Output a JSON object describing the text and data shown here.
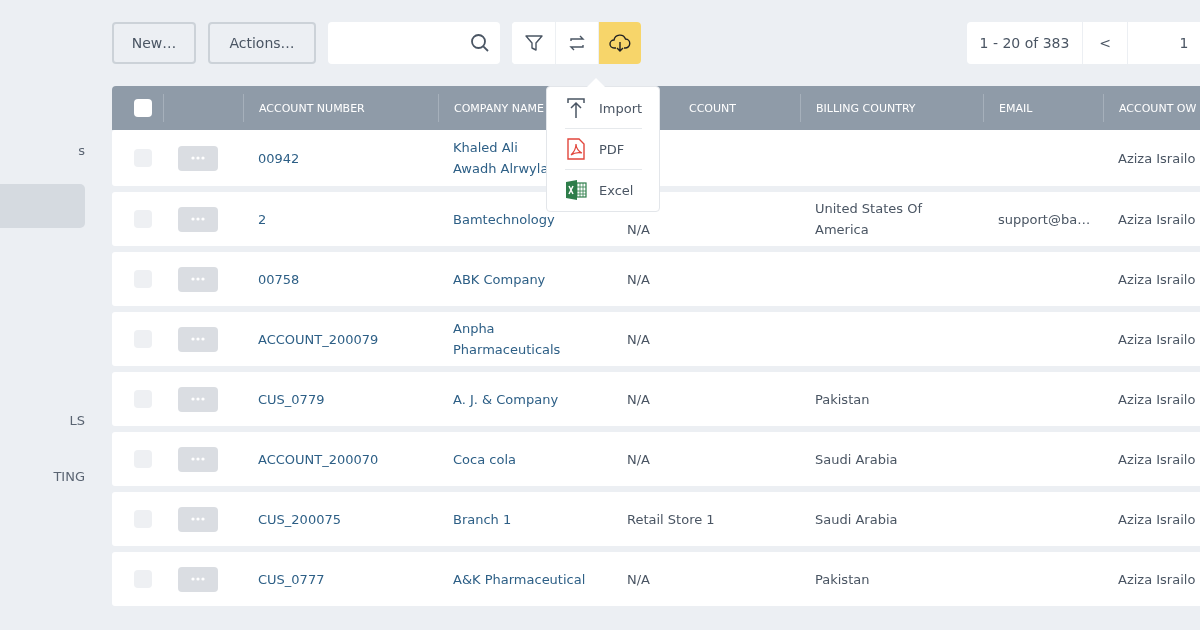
{
  "sidebar": {
    "items": [
      {
        "label": "s",
        "selected": false
      },
      {
        "selected": true
      },
      {
        "label": "LS",
        "selected": false
      },
      {
        "label": "TING",
        "selected": false
      }
    ]
  },
  "toolbar": {
    "buttons": [
      "New…",
      "Actions…"
    ],
    "tool_buttons": [
      {
        "kind": "filter",
        "selected": false
      },
      {
        "kind": "swap",
        "selected": false
      },
      {
        "kind": "download",
        "selected": true
      }
    ]
  },
  "export_menu": [
    {
      "kind": "import",
      "label": "Import"
    },
    {
      "kind": "pdf",
      "label": "PDF"
    },
    {
      "kind": "excel",
      "label": "Excel"
    }
  ],
  "pagination": {
    "range": "1 - 20 of 383",
    "prev": "<",
    "page": "1"
  },
  "table": {
    "all_checked": false,
    "columns": [
      "ACCOUNT NUMBER",
      "COMPANY NAME",
      "CCOUNT",
      "BILLING COUNTRY",
      "EMAIL",
      "ACCOUNT OW"
    ],
    "rows": [
      {
        "checked": false,
        "account_number": "00942",
        "company_name": "Khaled Ali Awadh Alrwyla",
        "billing_country": "",
        "email": "",
        "account_owner": "Aziza Israilo"
      },
      {
        "checked": false,
        "account_number": "2",
        "company_name": "Bamtechnology",
        "column_3": "N/A",
        "billing_country": "United States Of America",
        "email": "support@ba…",
        "account_owner": "Aziza Israilo"
      },
      {
        "checked": false,
        "account_number": "00758",
        "company_name": "ABK Company",
        "column_3": "N/A",
        "account_owner": "Aziza Israilo"
      },
      {
        "checked": false,
        "account_number": "ACCOUNT_200079",
        "company_name": "Anpha Pharmaceuticals",
        "column_3": "N/A",
        "account_owner": "Aziza Israilo"
      },
      {
        "checked": false,
        "account_number": "CUS_0779",
        "company_name": "A. J. & Company",
        "column_3": "N/A",
        "billing_country": "Pakistan",
        "account_owner": "Aziza Israilo"
      },
      {
        "checked": false,
        "account_number": "ACCOUNT_200070",
        "company_name": "Coca cola",
        "column_3": "N/A",
        "billing_country": "Saudi Arabia",
        "account_owner": "Aziza Israilo"
      },
      {
        "checked": false,
        "account_number": "CUS_200075",
        "company_name": "Branch 1",
        "column_3": "Retail Store 1",
        "billing_country": "Saudi Arabia",
        "account_owner": "Aziza Israilo"
      },
      {
        "checked": false,
        "account_number": "CUS_0777",
        "company_name": "A&K Pharmaceutical",
        "column_3": "N/A",
        "billing_country": "Pakistan",
        "account_owner": "Aziza Israilo"
      }
    ]
  }
}
